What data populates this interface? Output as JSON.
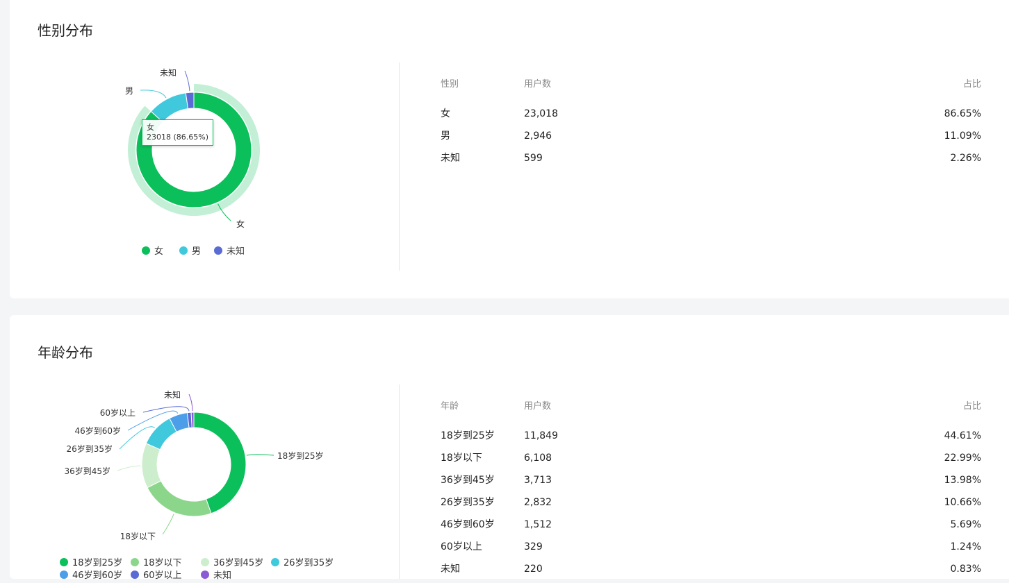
{
  "gender": {
    "title": "性别分布",
    "table": {
      "headers": [
        "性别",
        "用户数",
        "占比"
      ],
      "rows": [
        [
          "女",
          "23,018",
          "86.65%"
        ],
        [
          "男",
          "2,946",
          "11.09%"
        ],
        [
          "未知",
          "599",
          "2.26%"
        ]
      ]
    },
    "tooltip": {
      "name": "女",
      "value": "23018 (86.65%)"
    },
    "chart_data": {
      "type": "pie",
      "categories": [
        "女",
        "男",
        "未知"
      ],
      "values": [
        23018,
        2946,
        599
      ],
      "colors": [
        "#0bbf5a",
        "#40c8dc",
        "#5b6bd6"
      ],
      "highlighted": "女",
      "legend": "bottom"
    }
  },
  "age": {
    "title": "年龄分布",
    "table": {
      "headers": [
        "年龄",
        "用户数",
        "占比"
      ],
      "rows": [
        [
          "18岁到25岁",
          "11,849",
          "44.61%"
        ],
        [
          "18岁以下",
          "6,108",
          "22.99%"
        ],
        [
          "36岁到45岁",
          "3,713",
          "13.98%"
        ],
        [
          "26岁到35岁",
          "2,832",
          "10.66%"
        ],
        [
          "46岁到60岁",
          "1,512",
          "5.69%"
        ],
        [
          "60岁以上",
          "329",
          "1.24%"
        ],
        [
          "未知",
          "220",
          "0.83%"
        ]
      ]
    },
    "chart_data": {
      "type": "pie",
      "categories": [
        "18岁到25岁",
        "18岁以下",
        "36岁到45岁",
        "26岁到35岁",
        "46岁到60岁",
        "60岁以上",
        "未知"
      ],
      "values": [
        11849,
        6108,
        3713,
        2832,
        1512,
        329,
        220
      ],
      "colors": [
        "#0bbf5a",
        "#8cd68c",
        "#cdeecd",
        "#40c8dc",
        "#4d9ee8",
        "#5b6bd6",
        "#8c5ad6"
      ],
      "legend": "bottom"
    }
  }
}
